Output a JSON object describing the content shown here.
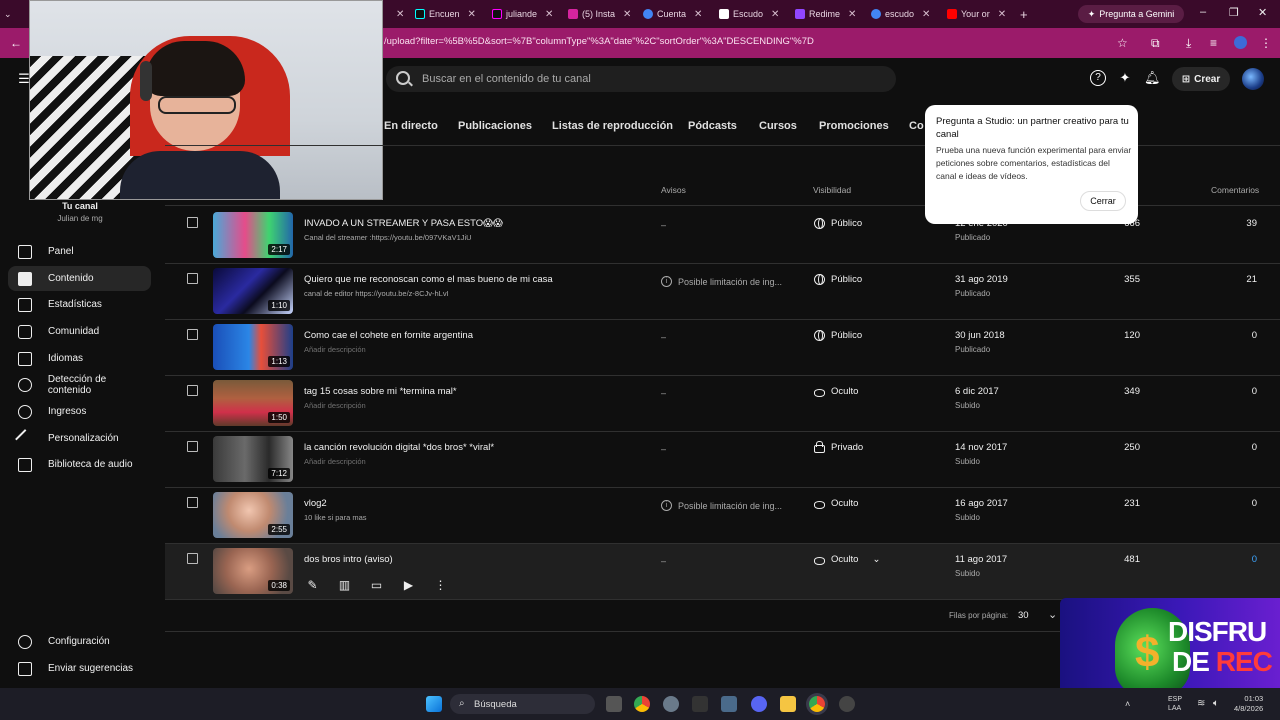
{
  "browser": {
    "tabs": [
      {
        "label": "Encuen",
        "color": "#111111"
      },
      {
        "label": "juliande",
        "color": "#111111"
      },
      {
        "label": "(5) Insta",
        "color": "#d6249f"
      },
      {
        "label": "Cuenta",
        "color": "#4285f4"
      },
      {
        "label": "Escudo",
        "color": "#ffffff"
      },
      {
        "label": "Redime",
        "color": "#9146ff"
      },
      {
        "label": "escudo",
        "color": "#4285f4"
      },
      {
        "label": "Your or",
        "color": "#ff0000"
      }
    ],
    "gemini_label": "Pregunta a Gemini",
    "url": "/upload?filter=%5B%5D&sort=%7B\"columnType\"%3A\"date\"%2C\"sortOrder\"%3A\"DESCENDING\"%7D"
  },
  "header": {
    "search_placeholder": "Buscar en el contenido de tu canal",
    "create_label": "Crear"
  },
  "channel": {
    "name": "Tu canal",
    "handle": "Julian de mg"
  },
  "sidebar": {
    "items": [
      {
        "label": "Panel"
      },
      {
        "label": "Contenido"
      },
      {
        "label": "Estadísticas"
      },
      {
        "label": "Comunidad"
      },
      {
        "label": "Idiomas"
      },
      {
        "label": "Detección de contenido"
      },
      {
        "label": "Ingresos"
      },
      {
        "label": "Personalización"
      },
      {
        "label": "Biblioteca de audio"
      }
    ],
    "bottom": [
      {
        "label": "Configuración"
      },
      {
        "label": "Enviar sugerencias"
      }
    ]
  },
  "content_tabs": [
    "En directo",
    "Publicaciones",
    "Listas de reproducción",
    "Pódcasts",
    "Cursos",
    "Promociones",
    "Co"
  ],
  "table": {
    "headers": {
      "avisos": "Avisos",
      "visibilidad": "Visibilidad",
      "comentarios": "Comentarios"
    },
    "rows": [
      {
        "title": "INVADO A UN STREAMER Y PASA ESTO😱😱",
        "desc": "Canal del streamer :https://youtu.be/097VKaV1JiU",
        "duration": "2:17",
        "avisos": "–",
        "visibility": "Público",
        "date": "12 ene 2020",
        "date_sub": "Publicado",
        "views": "666",
        "comments": "39"
      },
      {
        "title": "Quiero que me reconoscan como el mas bueno de mi casa",
        "desc": "canal de editor https://youtu.be/z-8CJv-hLvI",
        "duration": "1:10",
        "avisos": "Posible limitación de ing...",
        "visibility": "Público",
        "date": "31 ago 2019",
        "date_sub": "Publicado",
        "views": "355",
        "comments": "21"
      },
      {
        "title": "Como cae el cohete en fornite argentina",
        "desc": "Añadir descripción",
        "duration": "1:13",
        "avisos": "–",
        "visibility": "Público",
        "date": "30 jun 2018",
        "date_sub": "Publicado",
        "views": "120",
        "comments": "0"
      },
      {
        "title": "tag 15 cosas sobre mi *termina mal*",
        "desc": "Añadir descripción",
        "duration": "1:50",
        "avisos": "–",
        "visibility": "Oculto",
        "date": "6 dic 2017",
        "date_sub": "Subido",
        "views": "349",
        "comments": "0"
      },
      {
        "title": "la canción revolución digital *dos bros* *viral*",
        "desc": "Añadir descripción",
        "duration": "7:12",
        "avisos": "–",
        "visibility": "Privado",
        "date": "14 nov 2017",
        "date_sub": "Subido",
        "views": "250",
        "comments": "0"
      },
      {
        "title": "vlog2",
        "desc": "10 like si para mas",
        "duration": "2:55",
        "avisos": "Posible limitación de ing...",
        "visibility": "Oculto",
        "date": "16 ago 2017",
        "date_sub": "Subido",
        "views": "231",
        "comments": "0"
      },
      {
        "title": "dos bros intro (aviso)",
        "desc": "",
        "duration": "0:38",
        "avisos": "–",
        "visibility": "Oculto",
        "date": "11 ago 2017",
        "date_sub": "Subido",
        "views": "481",
        "comments": "0"
      }
    ]
  },
  "pagination": {
    "label": "Filas por página:",
    "value": "30"
  },
  "popup": {
    "title": "Pregunta a Studio: un partner creativo para tu canal",
    "body": "Prueba una nueva función experimental para enviar peticiones sobre comentarios, estadísticas del canal e ideas de vídeos.",
    "close": "Cerrar"
  },
  "overlay": {
    "line1": "DISFRU",
    "line2a": "DE ",
    "line2b": "REC"
  },
  "taskbar": {
    "search": "Búsqueda",
    "lang": "ESP\nLAA",
    "time": "01:03",
    "date": "4/8/2026"
  },
  "colors": {
    "accent_link": "#3ea6ff",
    "browser_frame": "#9b1b6a"
  }
}
